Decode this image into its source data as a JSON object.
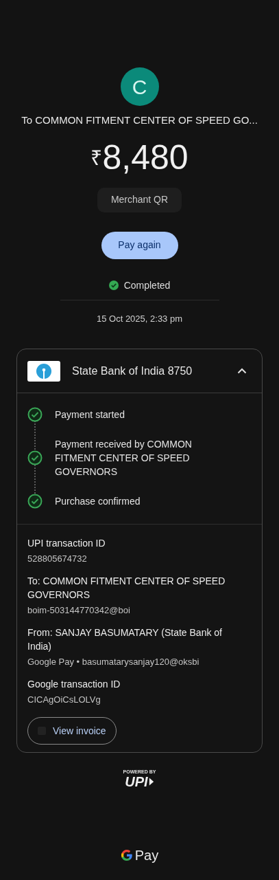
{
  "avatar": {
    "initial": "C"
  },
  "title": "To COMMON FITMENT CENTER OF SPEED GO...",
  "amount": {
    "currency": "₹",
    "value": "8,480"
  },
  "method_chip": "Merchant QR",
  "primary_button": "Pay again",
  "status": {
    "label": "Completed",
    "kind": "success"
  },
  "datetime": "15 Oct 2025, 2:33 pm",
  "card": {
    "bank": {
      "name": "State Bank of India 8750",
      "expanded": true
    },
    "timeline": [
      {
        "label": "Payment started",
        "done": true
      },
      {
        "label": "Payment received by COMMON FITMENT CENTER OF SPEED GOVERNORS",
        "done": true
      },
      {
        "label": "Purchase confirmed",
        "done": true
      }
    ],
    "details": [
      {
        "label": "UPI transaction ID",
        "value": "528805674732"
      },
      {
        "label": "To: COMMON FITMENT CENTER OF SPEED GOVERNORS",
        "value": "boim-503144770342@boi"
      },
      {
        "label": "From: SANJAY  BASUMATARY (State Bank of India)",
        "value": "Google Pay • basumatarysanjay120@oksbi"
      },
      {
        "label": "Google transaction ID",
        "value": "CICAgOiCsLOLVg"
      }
    ],
    "invoice_button": "View invoice"
  },
  "footer": {
    "powered_by": "POWERED BY",
    "upi": "UPI",
    "brand": "Pay"
  }
}
